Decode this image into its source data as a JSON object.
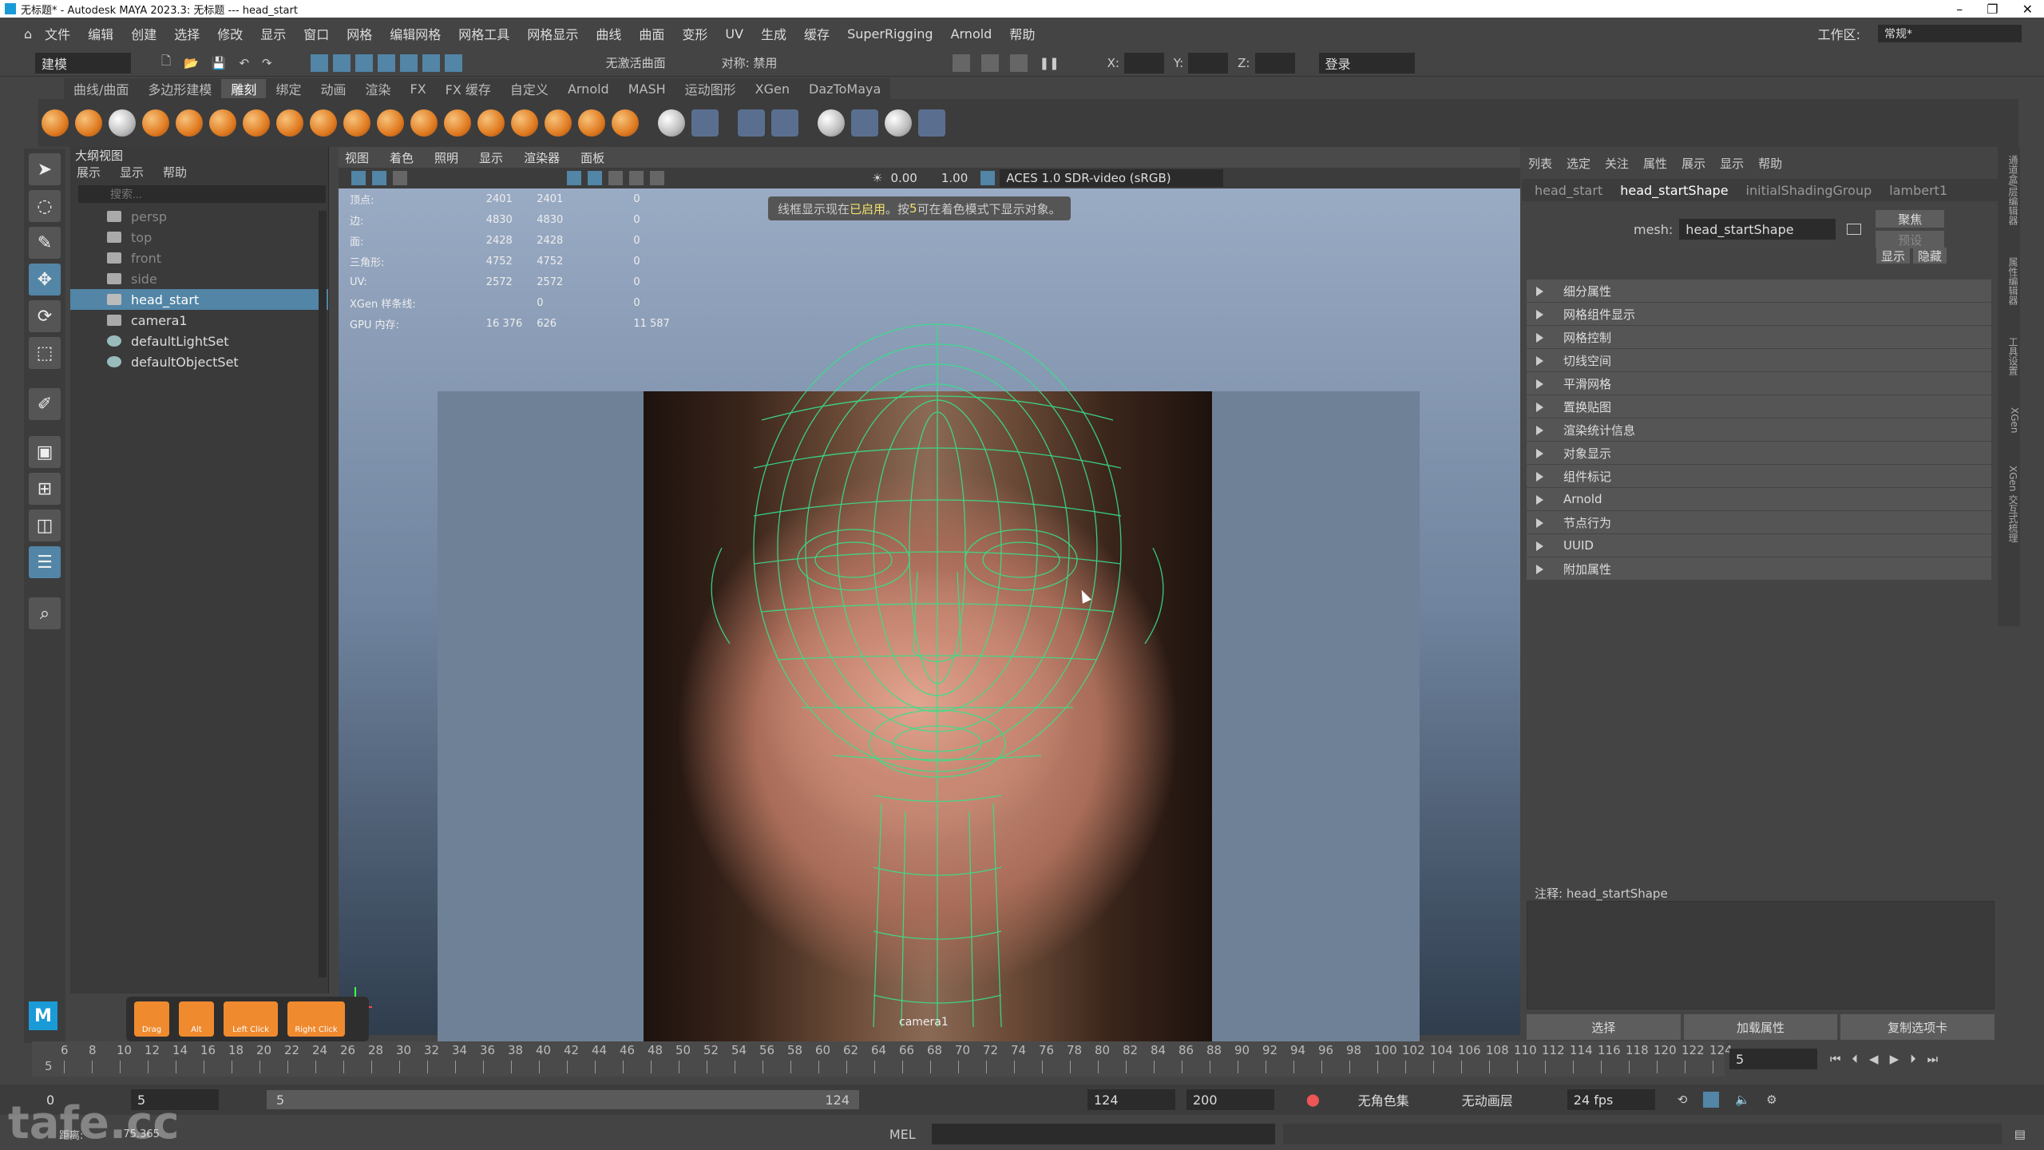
{
  "window": {
    "title": "无标题* - Autodesk MAYA 2023.3: 无标题   ---   head_start",
    "workspace_label": "工作区:",
    "workspace_value": "常规*"
  },
  "menus": [
    "文件",
    "编辑",
    "创建",
    "选择",
    "修改",
    "显示",
    "窗口",
    "网格",
    "编辑网格",
    "网格工具",
    "网格显示",
    "曲线",
    "曲面",
    "变形",
    "UV",
    "生成",
    "缓存",
    "SuperRigging",
    "Arnold",
    "帮助"
  ],
  "status_line": {
    "mode": "建模",
    "live_surface": "无激活曲面",
    "symmetry": "对称: 禁用",
    "x": "X:",
    "y": "Y:",
    "z": "Z:",
    "login": "登录"
  },
  "shelf_tabs": [
    "曲线/曲面",
    "多边形建模",
    "雕刻",
    "绑定",
    "动画",
    "渲染",
    "FX",
    "FX 缓存",
    "自定义",
    "Arnold",
    "MASH",
    "运动图形",
    "XGen",
    "DazToMaya"
  ],
  "shelf_active_tab": "雕刻",
  "outliner": {
    "title": "大纲视图",
    "menu": [
      "展示",
      "显示",
      "帮助"
    ],
    "search_placeholder": "搜索...",
    "items": [
      {
        "label": "persp",
        "icon": "camera-icon"
      },
      {
        "label": "top",
        "icon": "camera-icon"
      },
      {
        "label": "front",
        "icon": "camera-icon"
      },
      {
        "label": "side",
        "icon": "camera-icon"
      },
      {
        "label": "head_start",
        "icon": "mesh-icon"
      },
      {
        "label": "camera1",
        "icon": "camera-icon"
      },
      {
        "label": "defaultLightSet",
        "icon": "set-icon"
      },
      {
        "label": "defaultObjectSet",
        "icon": "set-icon"
      }
    ]
  },
  "viewport": {
    "menu": [
      "视图",
      "着色",
      "照明",
      "显示",
      "渲染器",
      "面板"
    ],
    "gamma_value": "0.00",
    "exposure_value": "1.00",
    "color_space": "ACES 1.0 SDR-video (sRGB)",
    "notice_a": "线框显示现在",
    "notice_b": "已启用",
    "notice_c": "。按 ",
    "notice_d": "5",
    "notice_e": " 可在着色模式下显示对象。",
    "hud": [
      [
        "顶点:",
        "2401",
        "2401",
        "0"
      ],
      [
        "边:",
        "4830",
        "4830",
        "0"
      ],
      [
        "面:",
        "2428",
        "2428",
        "0"
      ],
      [
        "三角形:",
        "4752",
        "4752",
        "0"
      ],
      [
        "UV:",
        "2572",
        "2572",
        "0"
      ],
      [
        "XGen 样条线:",
        "",
        "0",
        "0"
      ],
      [
        "GPU 内存:",
        "16 376",
        "626",
        "11 587"
      ]
    ],
    "camera_label": "camera1"
  },
  "gizmo_buttons": [
    "Drag",
    "Alt",
    "Left Click",
    "Right Click"
  ],
  "attribute_editor": {
    "menu": [
      "列表",
      "选定",
      "关注",
      "属性",
      "展示",
      "显示",
      "帮助"
    ],
    "tabs": [
      "head_start",
      "head_startShape",
      "initialShadingGroup",
      "lambert1"
    ],
    "active_tab": "head_startShape",
    "mesh_label": "mesh:",
    "mesh_value": "head_startShape",
    "focus_button": "聚焦",
    "preset_button": "预设",
    "show_button": "显示",
    "hide_button": "隐藏",
    "sections": [
      "细分属性",
      "网格组件显示",
      "网格控制",
      "切线空间",
      "平滑网格",
      "置换贴图",
      "渲染统计信息",
      "对象显示",
      "组件标记",
      "Arnold",
      "节点行为",
      "UUID",
      "附加属性"
    ],
    "notes_label": "注释:  head_startShape",
    "bottom_buttons": [
      "选择",
      "加载属性",
      "复制选项卡"
    ]
  },
  "right_strip_labels": [
    "通道盒/层编辑器",
    "属性编辑器",
    "工具设置",
    "XGen",
    "XGen 交互式梳理"
  ],
  "timeline": {
    "ticks": [
      "6",
      "8",
      "10",
      "12",
      "14",
      "16",
      "18",
      "20",
      "22",
      "24",
      "26",
      "28",
      "30",
      "32",
      "34",
      "36",
      "38",
      "40",
      "42",
      "44",
      "46",
      "48",
      "50",
      "52",
      "54",
      "56",
      "58",
      "60",
      "62",
      "64",
      "66",
      "68",
      "70",
      "72",
      "74",
      "76",
      "78",
      "80",
      "82",
      "84",
      "86",
      "88",
      "90",
      "92",
      "94",
      "96",
      "98",
      "100",
      "102",
      "104",
      "106",
      "108",
      "110",
      "112",
      "114",
      "116",
      "118",
      "120",
      "122",
      "124"
    ],
    "first_visible": "5",
    "current_frame": "5"
  },
  "range": {
    "start": "0",
    "anim_start": "5",
    "slider_start": "5",
    "slider_end": "124",
    "anim_end": "124",
    "end": "200",
    "character_set": "无角色集",
    "anim_layer": "无动画层",
    "fps": "24 fps"
  },
  "command_line": {
    "language": "MEL",
    "distance_label": "距离:",
    "distance_value": "75.365"
  },
  "watermark": "tafe.cc"
}
